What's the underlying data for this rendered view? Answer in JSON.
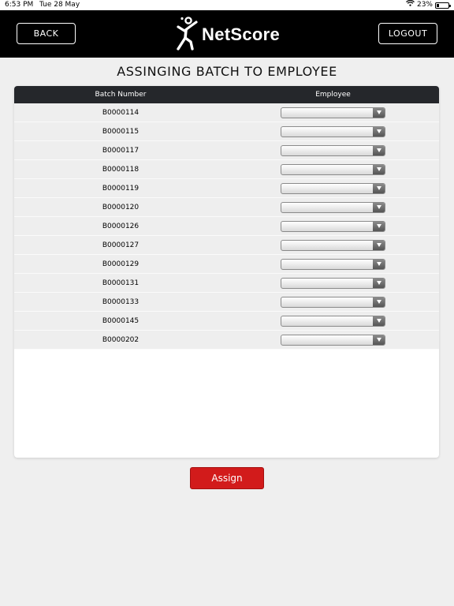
{
  "status_bar": {
    "time": "6:53 PM",
    "date": "Tue 28 May",
    "battery": "23%",
    "battery_level": 0.23,
    "icons": [
      "wifi-icon",
      "battery-icon"
    ]
  },
  "header": {
    "back_label": "BACK",
    "logout_label": "LOGOUT",
    "logo_text": "NetScore",
    "logo_icon": "person-figure-logo"
  },
  "page": {
    "title": "ASSINGING BATCH TO EMPLOYEE"
  },
  "table": {
    "columns": [
      "Batch Number",
      "Employee"
    ],
    "rows": [
      {
        "batch": "B0000114",
        "employee": ""
      },
      {
        "batch": "B0000115",
        "employee": ""
      },
      {
        "batch": "B0000117",
        "employee": ""
      },
      {
        "batch": "B0000118",
        "employee": ""
      },
      {
        "batch": "B0000119",
        "employee": ""
      },
      {
        "batch": "B0000120",
        "employee": ""
      },
      {
        "batch": "B0000126",
        "employee": ""
      },
      {
        "batch": "B0000127",
        "employee": ""
      },
      {
        "batch": "B0000129",
        "employee": ""
      },
      {
        "batch": "B0000131",
        "employee": ""
      },
      {
        "batch": "B0000133",
        "employee": ""
      },
      {
        "batch": "B0000145",
        "employee": ""
      },
      {
        "batch": "B0000202",
        "employee": ""
      }
    ]
  },
  "actions": {
    "assign_label": "Assign"
  },
  "colors": {
    "header_bg": "#000000",
    "table_header_bg": "#25272b",
    "assign_button": "#d21b1b",
    "page_bg": "#efefef"
  }
}
